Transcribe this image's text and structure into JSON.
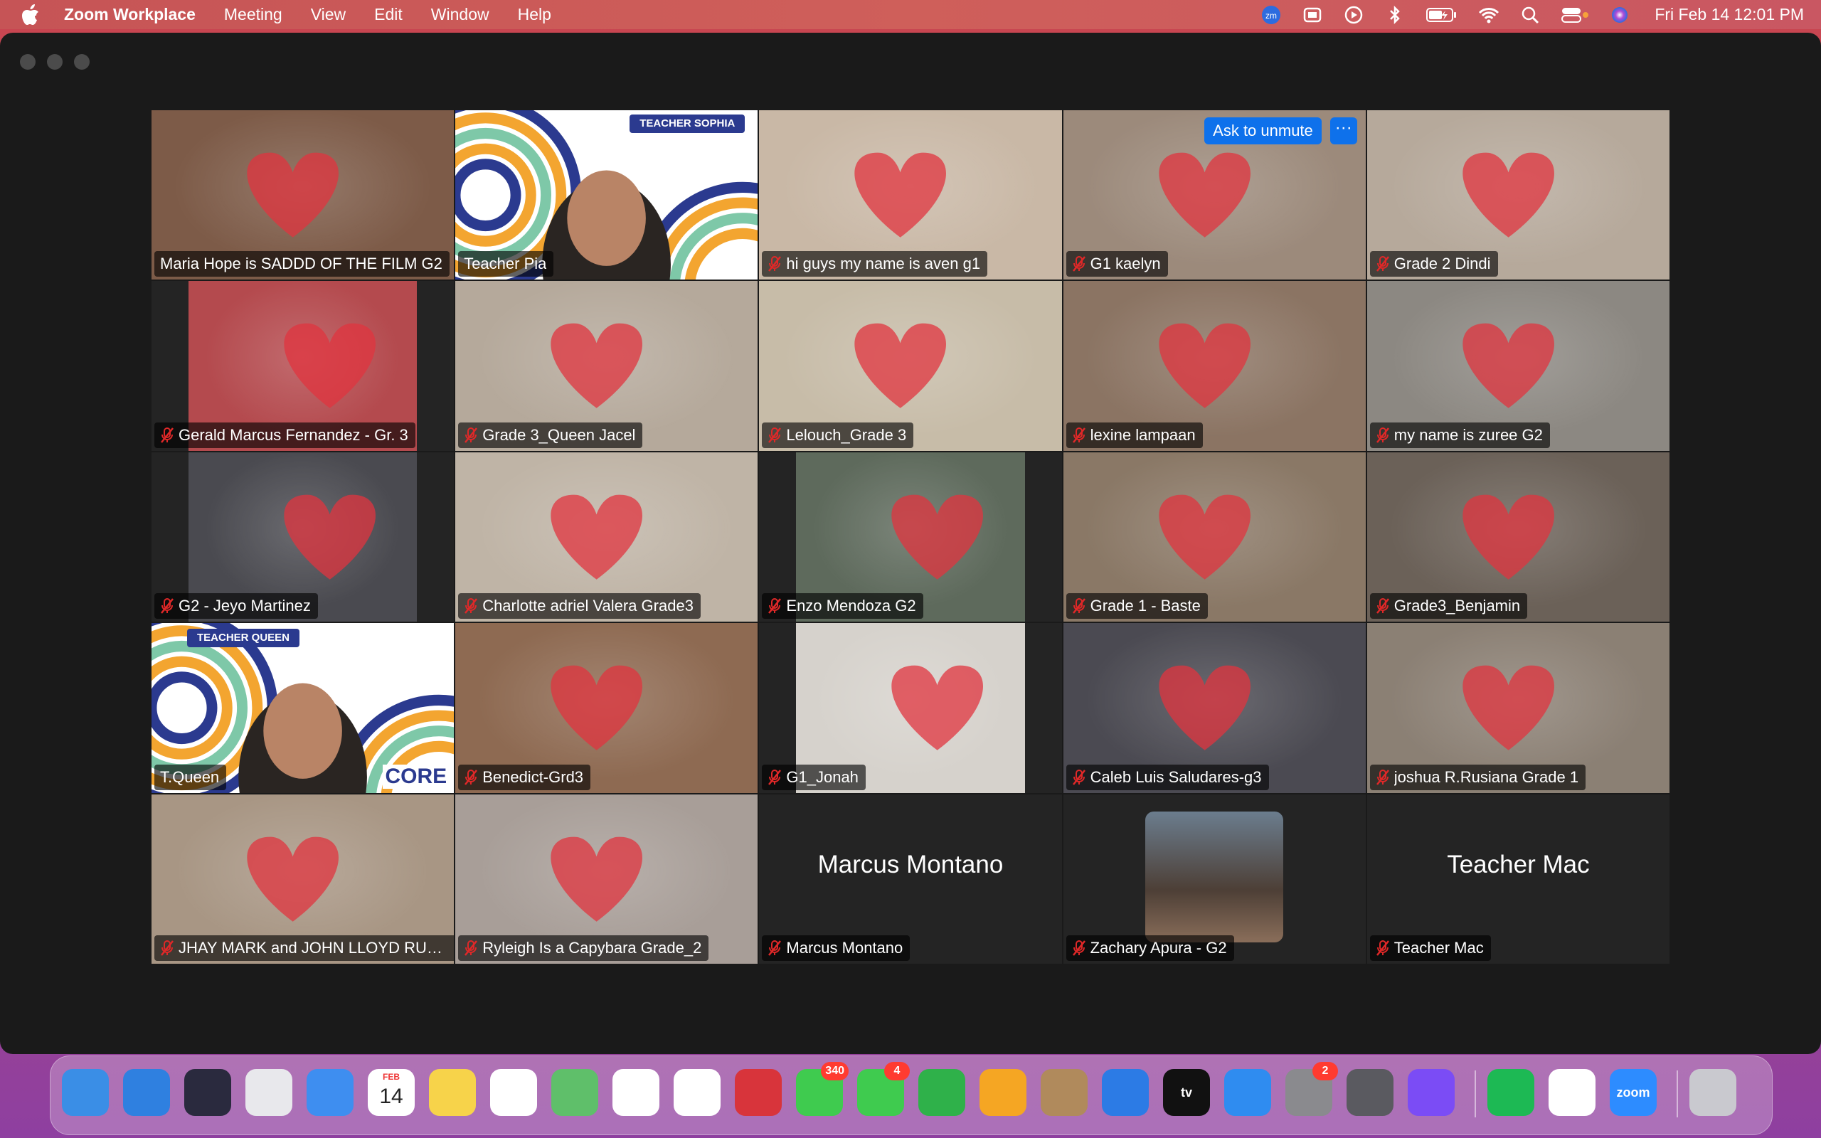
{
  "menubar": {
    "app_name": "Zoom Workplace",
    "items": [
      "Meeting",
      "View",
      "Edit",
      "Window",
      "Help"
    ],
    "clock": "Fri Feb 14  12:01 PM",
    "status_icons": [
      "zoom-icon",
      "finder-sync-icon",
      "play-icon",
      "bluetooth-icon",
      "battery-icon",
      "wifi-icon",
      "search-icon",
      "control-center-icon",
      "siri-icon"
    ],
    "zm_badge": "zm"
  },
  "controls": {
    "ask_to_unmute": "Ask to unmute",
    "more": "···"
  },
  "participants": [
    {
      "name": "Maria Hope is SADDD OF THE FILM G2",
      "muted": false,
      "bg": "#7d5b48"
    },
    {
      "name": "Teacher Pia",
      "muted": false,
      "banner": "TEACHER SOPHIA",
      "speaking": true
    },
    {
      "name": "hi guys my name is aven g1",
      "muted": true,
      "bg": "#c9b8a6"
    },
    {
      "name": "G1 kaelyn",
      "muted": true,
      "bg": "#9c8a7b"
    },
    {
      "name": "Grade 2 Dindi",
      "muted": true,
      "bg": "#b6a99b"
    },
    {
      "name": "Gerald Marcus Fernandez - Gr. 3",
      "muted": true,
      "bg": "#b44a4e",
      "narrow": true
    },
    {
      "name": "Grade 3_Queen Jacel",
      "muted": true,
      "bg": "#b5a99b"
    },
    {
      "name": "Lelouch_Grade 3",
      "muted": true,
      "bg": "#c7bca8"
    },
    {
      "name": "lexine lampaan",
      "muted": true,
      "bg": "#8b7463"
    },
    {
      "name": "my name is zuree G2",
      "muted": true,
      "bg": "#8c8882"
    },
    {
      "name": "G2 - Jeyo Martinez",
      "muted": true,
      "bg": "#4a4a50",
      "narrow": true
    },
    {
      "name": "Charlotte adriel Valera Grade3",
      "muted": true,
      "bg": "#bfb4a6"
    },
    {
      "name": "Enzo Mendoza G2",
      "muted": true,
      "bg": "#5e6a5c",
      "narrow": true
    },
    {
      "name": "Grade 1 - Baste",
      "muted": true,
      "bg": "#8a7866"
    },
    {
      "name": "Grade3_Benjamin",
      "muted": true,
      "bg": "#6b6158"
    },
    {
      "name": "T.Queen",
      "muted": false,
      "banner": "TEACHER QUEEN",
      "core": "CORE"
    },
    {
      "name": "Benedict-Grd3",
      "muted": true,
      "bg": "#8e6a52"
    },
    {
      "name": "G1_Jonah",
      "muted": true,
      "bg": "#d6d2cc",
      "narrow": true
    },
    {
      "name": "Caleb Luis Saludares-g3",
      "muted": true,
      "bg": "#4b4a52"
    },
    {
      "name": "joshua R.Rusiana Grade 1",
      "muted": true,
      "bg": "#8b8074"
    },
    {
      "name": "JHAY MARK and JOHN LLOYD RUSIANA",
      "muted": true,
      "bg": "#a89684"
    },
    {
      "name": "Ryleigh Is a Capybara Grade_2",
      "muted": true,
      "bg": "#a89e98"
    },
    {
      "name": "Marcus Montano",
      "muted": true,
      "center": "Marcus Montano"
    },
    {
      "name": "Zachary Apura - G2",
      "muted": true,
      "avatar": true
    },
    {
      "name": "Teacher Mac",
      "muted": true,
      "center": "Teacher Mac"
    }
  ],
  "dock": {
    "apps": [
      {
        "name": "finder-icon",
        "color": "#3a8ee6"
      },
      {
        "name": "safari-icon",
        "color": "#2f80e0"
      },
      {
        "name": "siri-icon",
        "color": "#2a2a3e"
      },
      {
        "name": "launchpad-icon",
        "color": "#e8e8ec"
      },
      {
        "name": "mail-icon",
        "color": "#3e8ef0"
      },
      {
        "name": "calendar-icon",
        "color": "#ffffff",
        "label": "14",
        "sub": "FEB"
      },
      {
        "name": "notes-icon",
        "color": "#f7d34a"
      },
      {
        "name": "freeform-icon",
        "color": "#ffffff"
      },
      {
        "name": "maps-icon",
        "color": "#5fbf6a"
      },
      {
        "name": "reminders-icon",
        "color": "#ffffff"
      },
      {
        "name": "photos-icon",
        "color": "#ffffff"
      },
      {
        "name": "photo-booth-icon",
        "color": "#d8343b"
      },
      {
        "name": "messages-icon",
        "color": "#3fcb4f",
        "badge": "340"
      },
      {
        "name": "facetime-icon",
        "color": "#3fcb4f",
        "badge": "4"
      },
      {
        "name": "numbers-icon",
        "color": "#2fb14a"
      },
      {
        "name": "pages-icon",
        "color": "#f5a623"
      },
      {
        "name": "contacts-icon",
        "color": "#b08a5c"
      },
      {
        "name": "keynote-icon",
        "color": "#2c7be5"
      },
      {
        "name": "apple-tv-icon",
        "color": "#111111",
        "label": "tv"
      },
      {
        "name": "app-store-icon",
        "color": "#2f8cf0"
      },
      {
        "name": "system-settings-icon",
        "color": "#8a8a8e",
        "badge": "2"
      },
      {
        "name": "screenshot-icon",
        "color": "#5a5a60"
      },
      {
        "name": "messenger-icon",
        "color": "#7b4cf5"
      },
      {
        "name": "spotify-icon",
        "color": "#1db954"
      },
      {
        "name": "chrome-icon",
        "color": "#ffffff"
      },
      {
        "name": "zoom-icon",
        "color": "#2d8cff",
        "label": "zoom"
      },
      {
        "name": "trash-icon",
        "color": "#c9c9cf"
      }
    ]
  }
}
